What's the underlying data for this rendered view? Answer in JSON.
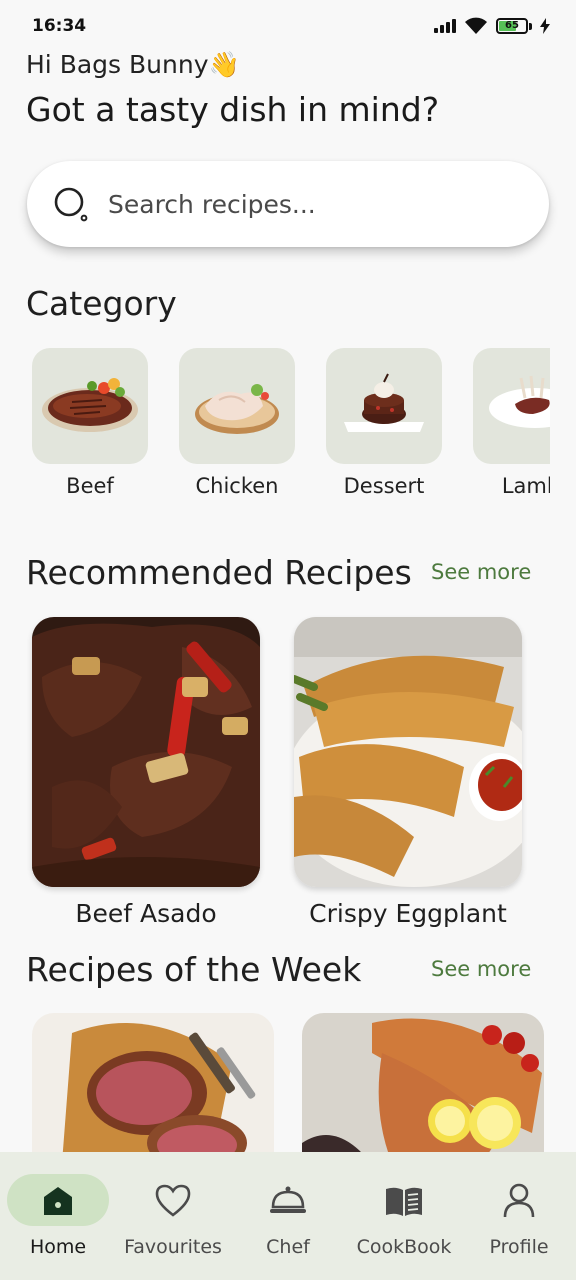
{
  "status_bar": {
    "time": "16:34",
    "battery": "65"
  },
  "greeting": {
    "hello": "Hi Bags Bunny👋",
    "headline": "Got a tasty dish in mind?"
  },
  "search": {
    "placeholder": "Search recipes..."
  },
  "category": {
    "title": "Category",
    "items": [
      {
        "label": "Beef"
      },
      {
        "label": "Chicken"
      },
      {
        "label": "Dessert"
      },
      {
        "label": "Lamb"
      }
    ]
  },
  "recommended": {
    "title": "Recommended Recipes",
    "see_more": "See more",
    "items": [
      {
        "name": "Beef Asado"
      },
      {
        "name": "Crispy Eggplant"
      }
    ]
  },
  "week": {
    "title": "Recipes of the Week",
    "see_more": "See more"
  },
  "nav": {
    "items": [
      {
        "label": "Home",
        "icon": "home-icon"
      },
      {
        "label": "Favourites",
        "icon": "heart-icon"
      },
      {
        "label": "Chef",
        "icon": "cloche-icon"
      },
      {
        "label": "CookBook",
        "icon": "book-icon"
      },
      {
        "label": "Profile",
        "icon": "person-icon"
      }
    ],
    "active_color": "#cfe2c4"
  },
  "colors": {
    "accent": "#4d7a3e",
    "background": "#f8f8f8",
    "nav_bg": "#e9ede4"
  }
}
